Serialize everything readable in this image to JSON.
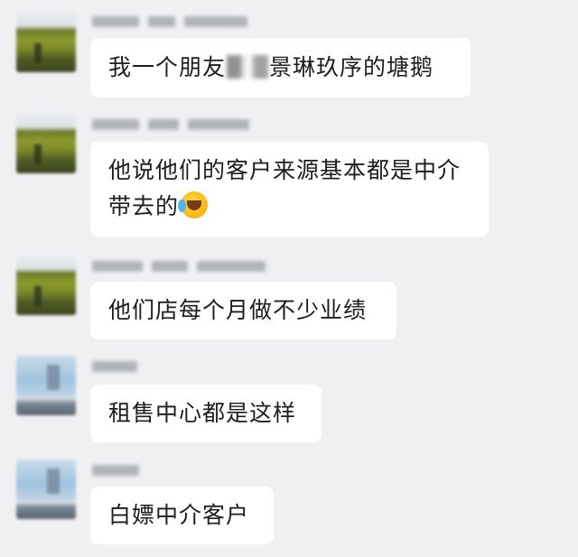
{
  "messages": [
    {
      "avatar": "field-photo-avatar",
      "text_before": "我一个朋友",
      "text_after": "景琳玖序的塘鹅"
    },
    {
      "avatar": "field-photo-avatar",
      "line1": "他说他们的客户来源基本都是中介",
      "line2": "带去的",
      "emoji": "crying-laughing-emoji"
    },
    {
      "avatar": "field-photo-avatar",
      "text": "他们店每个月做不少业绩"
    },
    {
      "avatar": "sky-photo-avatar",
      "text": "租售中心都是这样"
    },
    {
      "avatar": "sky-photo-avatar",
      "text": "白嫖中介客户"
    }
  ]
}
